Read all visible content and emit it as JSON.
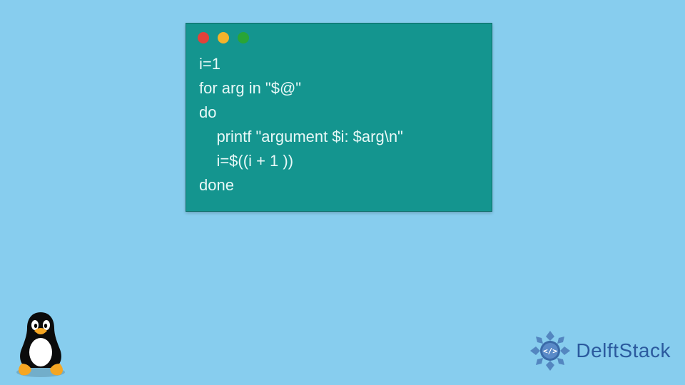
{
  "code": {
    "lines": [
      "i=1",
      "for arg in \"$@\"",
      "do",
      "    printf \"argument $i: $arg\\n\"",
      "    i=$((i + 1 ))",
      "done"
    ]
  },
  "brand": {
    "name": "DelftStack"
  },
  "colors": {
    "bg": "#87cdee",
    "window": "#14958f",
    "brand": "#2b5a9e"
  }
}
